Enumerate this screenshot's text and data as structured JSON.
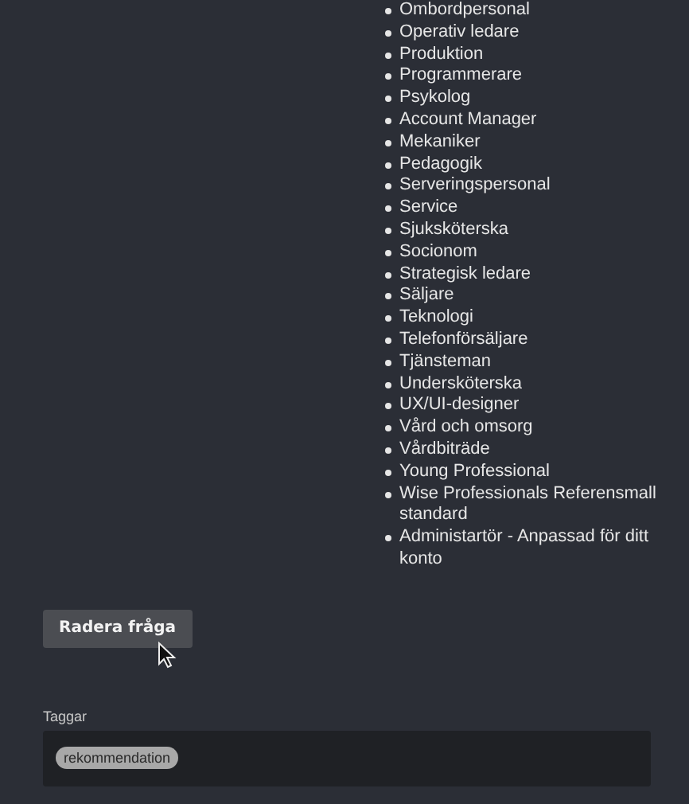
{
  "list_items": [
    "Ombordpersonal",
    "Operativ ledare",
    "Produktion",
    "Programmerare",
    "Psykolog",
    "Account Manager",
    "Mekaniker",
    "Pedagogik",
    "Serveringspersonal",
    "Service",
    "Sjuksköterska",
    "Socionom",
    "Strategisk ledare",
    "Säljare",
    "Teknologi",
    "Telefonförsäljare",
    "Tjänsteman",
    "Undersköterska",
    "UX/UI-designer",
    "Vård och omsorg",
    "Vårdbiträde",
    "Young Professional",
    "Wise Professionals Referensmall standard",
    "Administartör - Anpassad för ditt konto"
  ],
  "delete_button": "Radera fråga",
  "tags": {
    "label": "Taggar",
    "items": [
      "rekommendation"
    ]
  }
}
